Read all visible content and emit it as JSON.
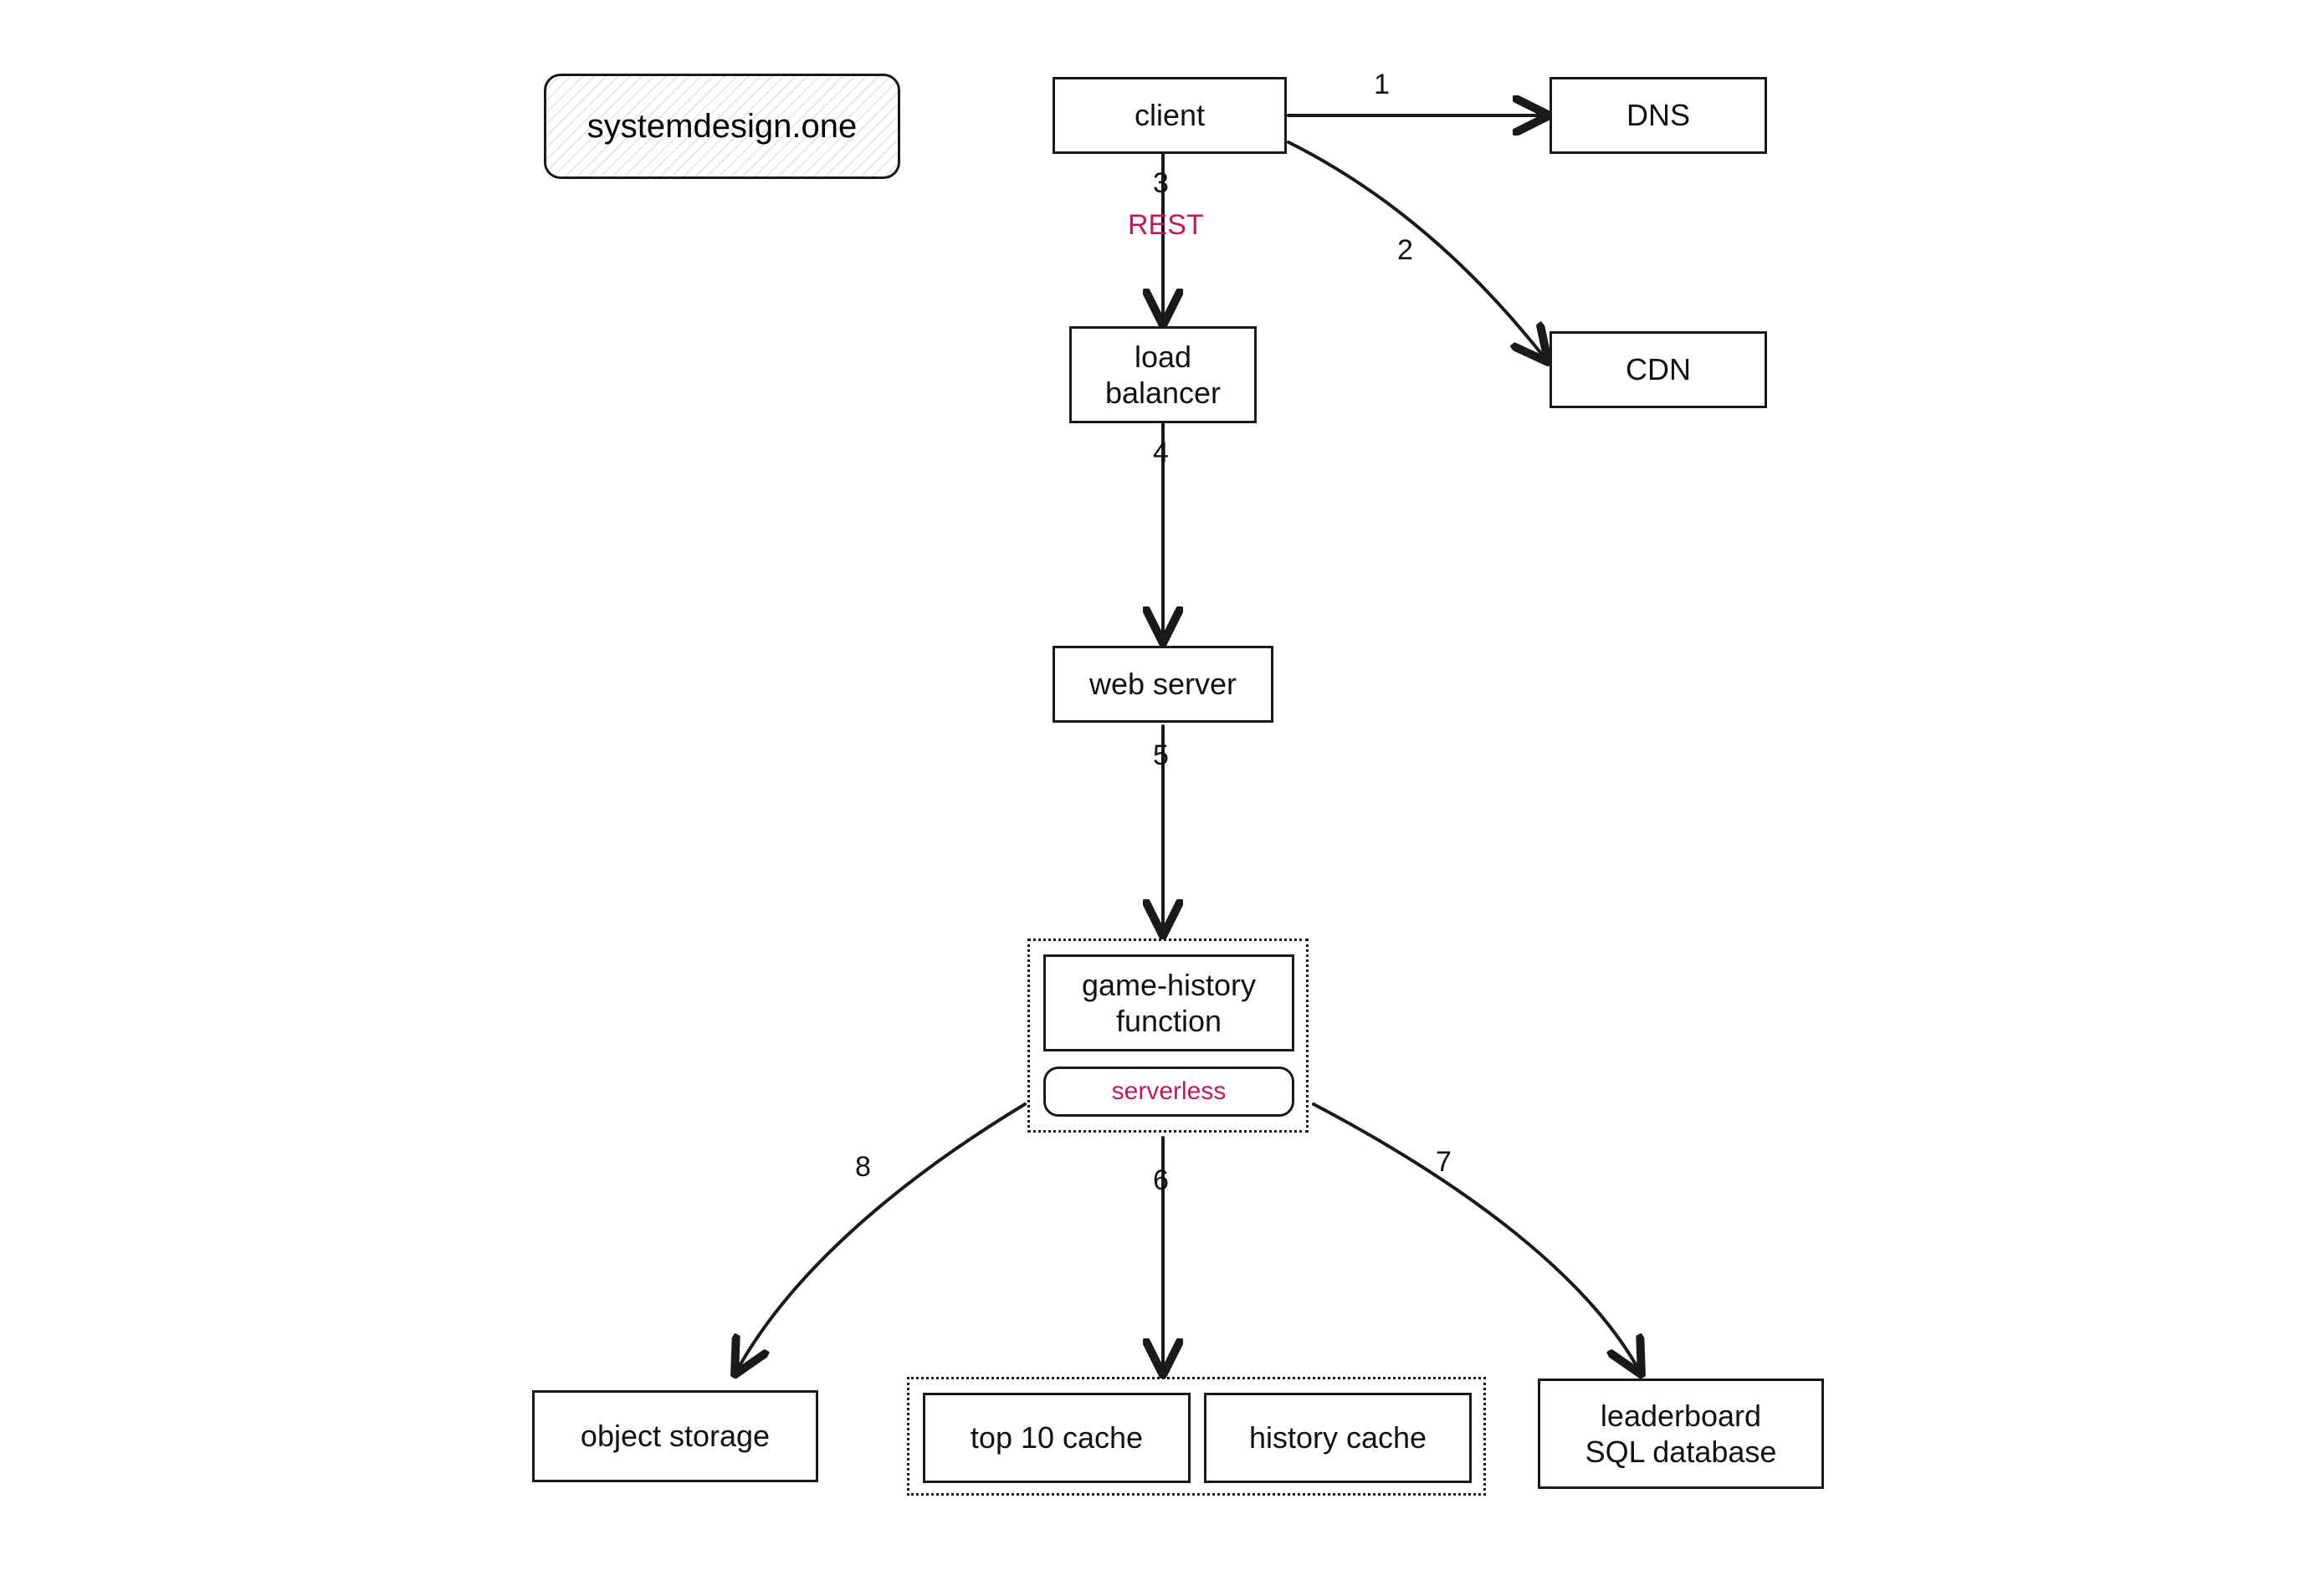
{
  "watermark": {
    "text": "systemdesign.one"
  },
  "nodes": {
    "client": {
      "label": "client"
    },
    "dns": {
      "label": "DNS"
    },
    "cdn": {
      "label": "CDN"
    },
    "loadBalancer": {
      "label": "load\nbalancer"
    },
    "webServer": {
      "label": "web server"
    },
    "gameHistory": {
      "label": "game-history\nfunction",
      "sub": "serverless"
    },
    "objectStorage": {
      "label": "object storage"
    },
    "top10Cache": {
      "label": "top 10 cache"
    },
    "historyCache": {
      "label": "history cache"
    },
    "leaderboard": {
      "label": "leaderboard\nSQL database"
    }
  },
  "edges": {
    "e1": {
      "num": "1"
    },
    "e2": {
      "num": "2"
    },
    "e3": {
      "num": "3",
      "tech": "REST"
    },
    "e4": {
      "num": "4"
    },
    "e5": {
      "num": "5"
    },
    "e6": {
      "num": "6"
    },
    "e7": {
      "num": "7"
    },
    "e8": {
      "num": "8"
    }
  },
  "colors": {
    "ink": "#1a1a1a",
    "accent": "#c2185b"
  }
}
